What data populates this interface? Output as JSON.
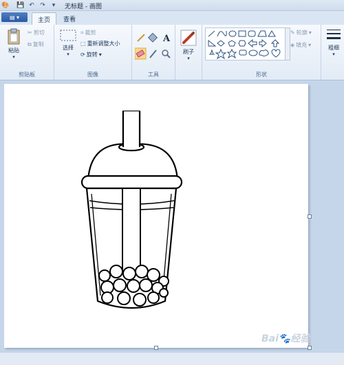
{
  "window": {
    "title": "无标题 - 画图",
    "file_menu": "▤ ▾"
  },
  "tabs": [
    {
      "label": "主页",
      "active": true
    },
    {
      "label": "查看",
      "active": false
    }
  ],
  "clipboard": {
    "paste": "粘贴",
    "cut": "剪切",
    "copy": "复制",
    "label": "剪贴板"
  },
  "image": {
    "select": "选择",
    "crop": "裁剪",
    "resize": "重新调整大小",
    "rotate": "旋转",
    "label": "图像"
  },
  "tools": {
    "label": "工具",
    "text_tool": "A"
  },
  "brushes": {
    "label": "刷子"
  },
  "shapes": {
    "outline": "轮廓",
    "fill": "填充",
    "label": "形状"
  },
  "size": {
    "label": "粗细"
  },
  "watermark": "Bai🐾经验",
  "colors": {
    "ribbon_bg": "#eef3fa",
    "canvas_bg": "#ffffff",
    "workspace": "#c6d6ea",
    "accent": "#2b5aa3"
  }
}
